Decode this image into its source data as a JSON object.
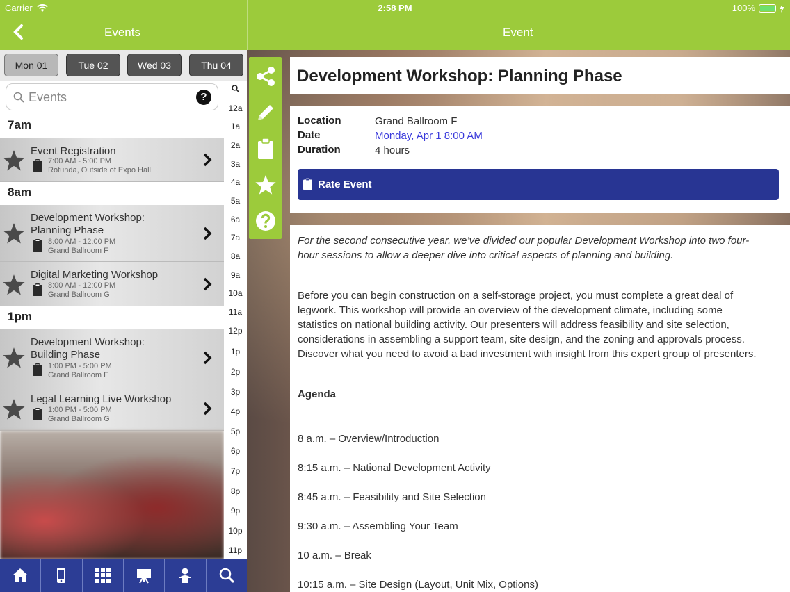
{
  "status": {
    "carrier": "Carrier",
    "time": "2:58 PM",
    "battery": "100%"
  },
  "nav": {
    "left_title": "Events",
    "right_title": "Event"
  },
  "days": [
    "Mon 01",
    "Tue 02",
    "Wed 03",
    "Thu 04"
  ],
  "search": {
    "placeholder": "Events",
    "help": "?"
  },
  "hour_headers": [
    "7am",
    "8am",
    "1pm"
  ],
  "events": [
    {
      "title_1": "Event Registration",
      "title_2": "",
      "time": "7:00 AM - 5:00 PM",
      "location": "Rotunda, Outside of Expo Hall"
    },
    {
      "title_1": "Development Workshop:",
      "title_2": "Planning Phase",
      "time": "8:00 AM - 12:00 PM",
      "location": "Grand Ballroom F"
    },
    {
      "title_1": "Digital Marketing Workshop",
      "title_2": "",
      "time": "8:00 AM - 12:00 PM",
      "location": "Grand Ballroom G"
    },
    {
      "title_1": "Development Workshop:",
      "title_2": "Building Phase",
      "time": "1:00 PM - 5:00 PM",
      "location": "Grand Ballroom F"
    },
    {
      "title_1": "Legal Learning Live Workshop",
      "title_2": "",
      "time": "1:00 PM - 5:00 PM",
      "location": "Grand Ballroom G"
    }
  ],
  "hour_index": [
    "12a",
    "1a",
    "2a",
    "3a",
    "4a",
    "5a",
    "6a",
    "7a",
    "8a",
    "9a",
    "10a",
    "11a",
    "12p",
    "1p",
    "2p",
    "3p",
    "4p",
    "5p",
    "6p",
    "7p",
    "8p",
    "9p",
    "10p",
    "11p"
  ],
  "tabbar": [
    "home-icon",
    "mobile-icon",
    "qr-grid-icon",
    "presentation-icon",
    "attendee-icon",
    "search-icon"
  ],
  "side_tools": [
    "share-icon",
    "pencil-icon",
    "clipboard-icon",
    "star-icon",
    "help-icon"
  ],
  "event": {
    "title": "Development Workshop: Planning Phase",
    "location_label": "Location",
    "location": "Grand Ballroom F",
    "date_label": "Date",
    "date": "Monday, Apr 1 8:00 AM",
    "duration_label": "Duration",
    "duration": "4 hours",
    "rate_label": "Rate Event",
    "intro_1": "For the second consecutive year, we’ve divided our popular Development Workshop into two four-",
    "intro_2": "hour sessions to allow a deeper dive into critical aspects of planning and building.",
    "body_1": "Before you can begin construction on a self-storage project, you must complete a great deal of",
    "body_2": "legwork. This workshop will provide an overview of the development climate, including some",
    "body_3": "statistics on national building activity. Our presenters will address feasibility and site selection,",
    "body_4": "considerations in assembling a support team, site design, and the zoning and approvals process.",
    "body_5": "Discover what you need to avoid a bad investment with insight from this expert group of presenters.",
    "agenda_label": "Agenda",
    "agenda": [
      "8 a.m. – Overview/Introduction",
      "8:15 a.m. – National Development Activity",
      "8:45 a.m. – Feasibility and Site Selection",
      "9:30 a.m. – Assembling Your Team",
      "10 a.m. – Break",
      "10:15 a.m. – Site Design (Layout, Unit Mix, Options)"
    ]
  },
  "colors": {
    "brand_green": "#9ccb3b",
    "tab_blue": "#2c3d95",
    "rate_blue": "#283593",
    "link": "#3a3adb"
  }
}
